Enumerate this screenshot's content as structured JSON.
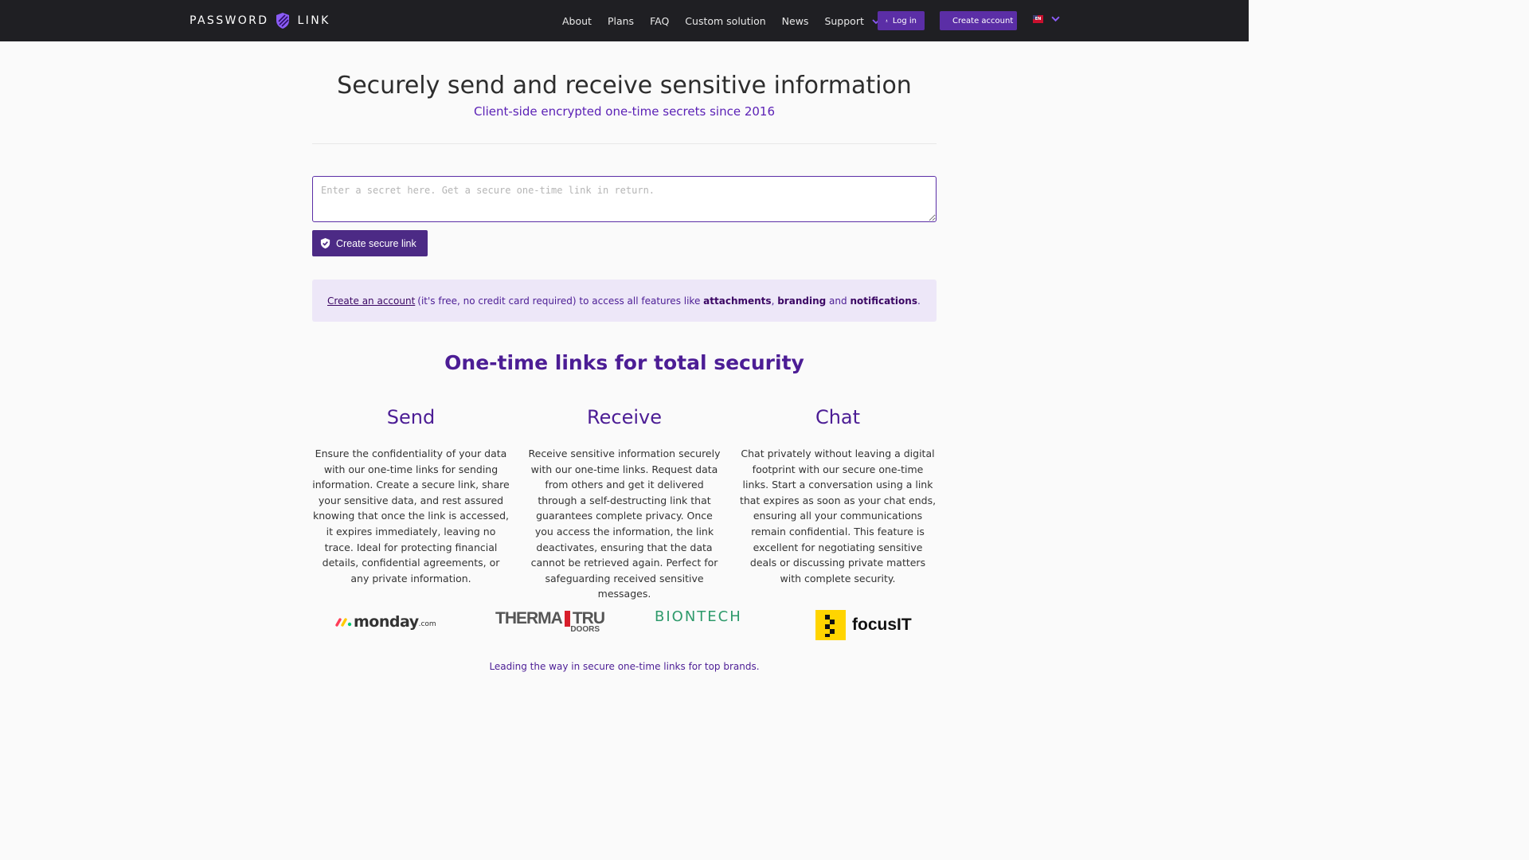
{
  "nav": {
    "brand_left": "PASSWORD",
    "brand_right": "LINK",
    "links": [
      "About",
      "Plans",
      "FAQ",
      "Custom solution",
      "News",
      "Support"
    ],
    "login": "Log in",
    "create_account": "Create account",
    "lang": "EN"
  },
  "hero": {
    "title": "Securely send and receive sensitive information",
    "subtitle": "Client-side encrypted one-time secrets since 2016"
  },
  "form": {
    "placeholder": "Enter a secret here. Get a secure one-time link in return.",
    "button": "Create secure link"
  },
  "callout": {
    "link": "Create an account",
    "text1": "(it's free, no credit card required) to access all features like",
    "f1": "attachments",
    "sep1": ",",
    "f2": "branding",
    "and": "and",
    "f3": "notifications",
    "end": "."
  },
  "features": {
    "title": "One-time links for total security",
    "items": [
      {
        "heading": "Send",
        "body": "Ensure the confidentiality of your data with our one-time links for sending information. Create a secure link, share your sensitive data, and rest assured knowing that once the link is accessed, it expires immediately, leaving no trace. Ideal for protecting financial details, confidential agreements, or any private information."
      },
      {
        "heading": "Receive",
        "body": "Receive sensitive information securely with our one-time links. Request data from others and get it delivered through a self-destructing link that guarantees complete privacy. Once you access the information, the link deactivates, ensuring that the data cannot be retrieved again. Perfect for safeguarding received sensitive messages."
      },
      {
        "heading": "Chat",
        "body": "Chat privately without leaving a digital footprint with our secure one-time links. Start a conversation using a link that expires as soon as your chat ends, ensuring all your communications remain confidential. This feature is excellent for negotiating sensitive deals or discussing private matters with complete security."
      }
    ]
  },
  "logos": {
    "monday": "monday",
    "monday_suffix": ".com",
    "therma_a": "THERMA",
    "therma_b": "TRU",
    "therma_doors": "DOORS",
    "biontech": "BIONTECH",
    "focus": "focusIT"
  },
  "tagline": "Leading the way in secure one-time links for top brands.",
  "colors": {
    "nav_bg": "#1f1f23",
    "accent": "#5b2ea6",
    "accent_text": "#4c1d95",
    "callout_bg": "#ede7f8"
  }
}
